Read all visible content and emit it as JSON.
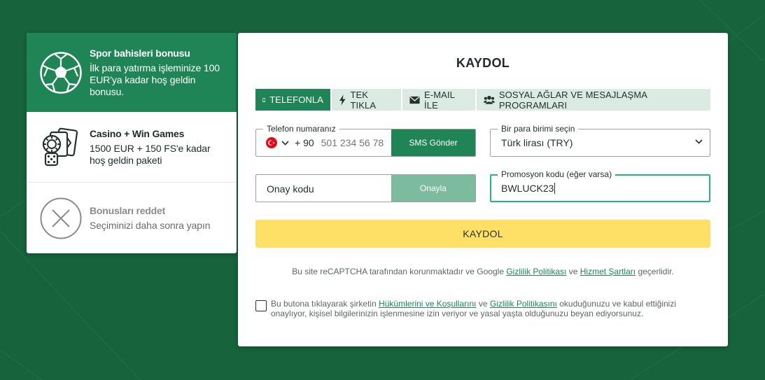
{
  "bonuses": [
    {
      "title": "Spor bahisleri bonusu",
      "desc": "İlk para yatırma işleminize 100 EUR'ya kadar hoş geldin bonusu.",
      "icon": "soccer-ball-icon",
      "selected": true
    },
    {
      "title": "Casino + Win Games",
      "desc": "1500 EUR + 150 FS'e kadar hoş geldin paketi",
      "icon": "casino-cards-icon",
      "selected": false
    },
    {
      "title": "Bonusları reddet",
      "desc": "Seçiminizi daha sonra yapın",
      "icon": "close-circle-icon",
      "selected": false
    }
  ],
  "register": {
    "title": "KAYDOL",
    "tabs": [
      {
        "label": "TELEFONLA",
        "icon": "phone-icon",
        "active": true
      },
      {
        "label": "TEK TIKLA",
        "icon": "lightning-icon",
        "active": false
      },
      {
        "label": "E-MAIL İLE",
        "icon": "envelope-icon",
        "active": false
      },
      {
        "label": "SOSYAL AĞLAR VE MESAJLAŞMA PROGRAMLARI",
        "icon": "users-icon",
        "active": false
      }
    ],
    "phone": {
      "label": "Telefon numaranız",
      "prefix": "+ 90",
      "placeholder": "501 234 56 78",
      "value": "",
      "sms_button": "SMS Gönder"
    },
    "currency": {
      "label": "Bir para birimi seçin",
      "value": "Türk lirası (TRY)"
    },
    "confirm": {
      "placeholder": "Onay kodu",
      "button": "Onayla"
    },
    "promo": {
      "label": "Promosyon kodu (eğer varsa)",
      "value": "BWLUCK23"
    },
    "submit_label": "KAYDOL",
    "recaptcha": {
      "prefix": "Bu site reCAPTCHA tarafından korunmaktadır ve Google",
      "privacy_link": "Gizlilik Politikası",
      "and": "ve",
      "terms_link": "Hizmet Şartları",
      "suffix": "geçerlidir."
    },
    "terms": {
      "prefix": "Bu butona tıklayarak şirketin",
      "terms_link": "Hükümlerini ve Koşullarını",
      "and": "ve",
      "privacy_link": "Gizlilik Politikasını",
      "suffix": "okuduğunuzu ve kabul ettiğinizi onaylıyor, kişisel bilgilerinizin işlenmesine izin veriyor ve yasal yaşta olduğunuzu beyan ediyorsunuz.",
      "checked": false
    }
  },
  "colors": {
    "background": "#17633b",
    "accent": "#1f8556",
    "submit": "#ffe066",
    "promo_border": "#23b77e"
  }
}
